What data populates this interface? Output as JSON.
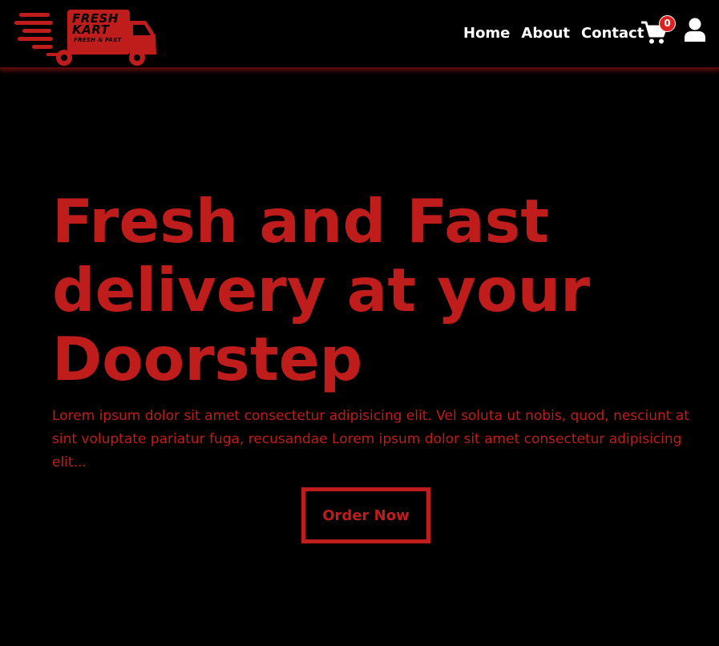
{
  "logo": {
    "line1": "FRESH",
    "line2": "KART",
    "line3": "FRESH & FAST",
    "icon": "delivery-truck-icon",
    "color": "#bf1c1c"
  },
  "nav": {
    "links": [
      "Home",
      "About",
      "Contact"
    ],
    "cart_count": "0",
    "cart_icon": "shopping-cart-icon",
    "user_icon": "user-icon"
  },
  "hero": {
    "title": "Fresh and Fast delivery at your Doorstep",
    "description": "Lorem ipsum dolor sit amet consectetur adipisicing elit. Vel soluta ut nobis, quod, nesciunt at sint voluptate pariatur fuga, recusandae Lorem ipsum dolor sit amet consectetur adipisicing elit...",
    "cta_label": "Order Now"
  },
  "colors": {
    "accent": "#bf1c1c",
    "background": "#000000",
    "nav_text": "#ffffff",
    "badge": "#e02020"
  }
}
